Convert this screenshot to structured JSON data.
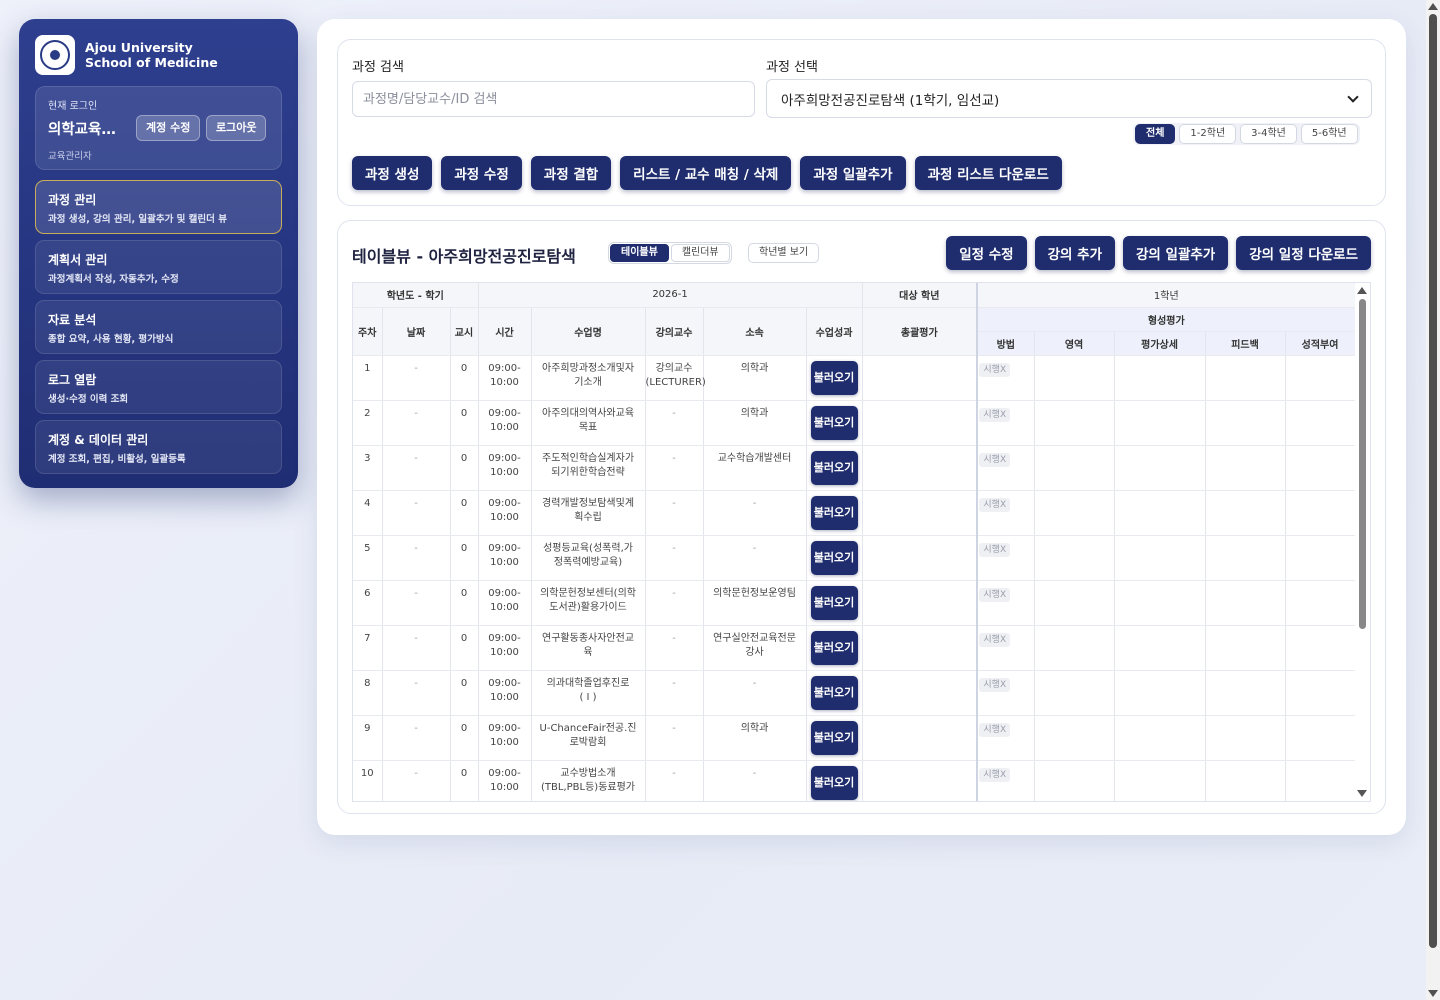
{
  "brand": {
    "line1": "Ajou University",
    "line2": "School of Medicine"
  },
  "login": {
    "caption": "현재 로그인",
    "name": "의학교육…",
    "role": "교육관리자",
    "edit_label": "계정 수정",
    "logout_label": "로그아웃"
  },
  "nav": [
    {
      "title": "과정 관리",
      "sub": "과정 생성, 강의 관리, 일괄추가 및 캘린더 뷰"
    },
    {
      "title": "계획서 관리",
      "sub": "과정계획서 작성, 자동추가, 수정"
    },
    {
      "title": "자료 분석",
      "sub": "종합 요약, 사용 현황, 평가방식"
    },
    {
      "title": "로그 열람",
      "sub": "생성·수정 이력 조회"
    },
    {
      "title": "계정 & 데이터 관리",
      "sub": "계정 조회, 편집, 비활성, 일괄등록"
    }
  ],
  "course_search": {
    "label": "과정 검색",
    "placeholder": "과정명/담당교수/ID 검색"
  },
  "course_select": {
    "label": "과정 선택",
    "value": "아주희망전공진로탐색 (1학기, 임선교)"
  },
  "grade_filter": [
    "전체",
    "1-2학년",
    "3-4학년",
    "5-6학년"
  ],
  "course_actions": [
    "과정 생성",
    "과정 수정",
    "과정 결합",
    "리스트 / 교수 매칭 / 삭제",
    "과정 일괄추가",
    "과정 리스트 다운로드"
  ],
  "table_view": {
    "title": "테이블뷰 - 아주희망전공진로탐색",
    "toggle": [
      "테이블뷰",
      "캘린더뷰"
    ],
    "year_view": "학년별 보기",
    "actions": [
      "일정 수정",
      "강의 추가",
      "강의 일괄추가",
      "강의 일정 다운로드"
    ]
  },
  "table": {
    "group1": "학년도 - 학기",
    "group1_value": "2026-1",
    "group2": "대상 학년",
    "group3": "1학년",
    "group4": "형성평가",
    "cols": [
      "주차",
      "날짜",
      "교시",
      "시간",
      "수업명",
      "강의교수",
      "소속",
      "수업성과",
      "총괄평가",
      "방법",
      "영역",
      "평가상세",
      "피드백",
      "성적부여"
    ],
    "load_label": "불러오기",
    "chip_label": "시행X",
    "rows": [
      {
        "week": "1",
        "date": "-",
        "period": "0",
        "t1": "09:00-",
        "t2": "10:00",
        "name1": "아주희망과정소개및자",
        "name2": "기소개",
        "prof1": "강의교수",
        "prof2": "(LECTURER)",
        "dept1": "의학과",
        "dept2": ""
      },
      {
        "week": "2",
        "date": "-",
        "period": "0",
        "t1": "09:00-",
        "t2": "10:00",
        "name1": "아주의대의역사와교육",
        "name2": "목표",
        "prof1": "-",
        "prof2": "",
        "dept1": "의학과",
        "dept2": ""
      },
      {
        "week": "3",
        "date": "-",
        "period": "0",
        "t1": "09:00-",
        "t2": "10:00",
        "name1": "주도적인학습실계자가",
        "name2": "되기위한학습전략",
        "prof1": "-",
        "prof2": "",
        "dept1": "교수학습개발센터",
        "dept2": ""
      },
      {
        "week": "4",
        "date": "-",
        "period": "0",
        "t1": "09:00-",
        "t2": "10:00",
        "name1": "경력개발정보탐색및계",
        "name2": "획수립",
        "prof1": "-",
        "prof2": "",
        "dept1": "-",
        "dept2": ""
      },
      {
        "week": "5",
        "date": "-",
        "period": "0",
        "t1": "09:00-",
        "t2": "10:00",
        "name1": "성평등교육(성폭력,가",
        "name2": "정폭력예방교육)",
        "prof1": "-",
        "prof2": "",
        "dept1": "-",
        "dept2": ""
      },
      {
        "week": "6",
        "date": "-",
        "period": "0",
        "t1": "09:00-",
        "t2": "10:00",
        "name1": "의학문헌정보센터(의학",
        "name2": "도서관)활용가이드",
        "prof1": "-",
        "prof2": "",
        "dept1": "의학문헌정보운영팀",
        "dept2": ""
      },
      {
        "week": "7",
        "date": "-",
        "period": "0",
        "t1": "09:00-",
        "t2": "10:00",
        "name1": "연구활동종사자안전교",
        "name2": "육",
        "prof1": "-",
        "prof2": "",
        "dept1": "연구실안전교육전문",
        "dept2": "강사"
      },
      {
        "week": "8",
        "date": "-",
        "period": "0",
        "t1": "09:00-",
        "t2": "10:00",
        "name1": "의과대학졸업후진로",
        "name2": "( I )",
        "prof1": "-",
        "prof2": "",
        "dept1": "-",
        "dept2": ""
      },
      {
        "week": "9",
        "date": "-",
        "period": "0",
        "t1": "09:00-",
        "t2": "10:00",
        "name1": "U-ChanceFair전공.진",
        "name2": "로박람회",
        "prof1": "-",
        "prof2": "",
        "dept1": "의학과",
        "dept2": ""
      },
      {
        "week": "10",
        "date": "-",
        "period": "0",
        "t1": "09:00-",
        "t2": "10:00",
        "name1": "교수방법소개",
        "name2": "(TBL,PBL등)동료평가",
        "prof1": "-",
        "prof2": "",
        "dept1": "-",
        "dept2": ""
      }
    ]
  }
}
